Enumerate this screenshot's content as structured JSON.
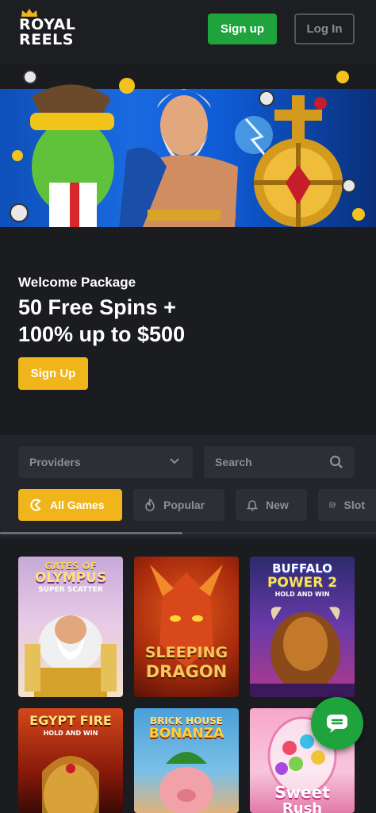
{
  "header": {
    "logo_line1": "ROYAL",
    "logo_line2": "REELS",
    "signup_label": "Sign up",
    "login_label": "Log In"
  },
  "promo": {
    "subtitle": "Welcome Package",
    "title_line1": "50 Free Spins +",
    "title_line2": "100% up to $500",
    "cta_label": "Sign Up"
  },
  "filters": {
    "providers_label": "Providers",
    "search_placeholder": "Search",
    "tabs": [
      {
        "label": "All Games",
        "icon": "all-games-icon",
        "active": true
      },
      {
        "label": "Popular",
        "icon": "flame-icon",
        "active": false
      },
      {
        "label": "New",
        "icon": "bell-icon",
        "active": false
      },
      {
        "label": "Slot",
        "icon": "slot-icon",
        "active": false
      }
    ]
  },
  "games": [
    {
      "title_line1": "GATES OF",
      "title_line2": "OLYMPUS",
      "title_line3": "SUPER SCATTER"
    },
    {
      "title_line1": "SLEEPING",
      "title_line2": "DRAGON"
    },
    {
      "title_line1": "BUFFALO",
      "title_line2": "POWER 2",
      "title_line3": "HOLD AND WIN"
    },
    {
      "title_line1": "EGYPT FIRE",
      "title_line2": "HOLD AND WIN"
    },
    {
      "title_line1": "BRICK HOUSE",
      "title_line2": "BONANZA"
    },
    {
      "title_line1": "Sweet",
      "title_line2": "Rush"
    }
  ],
  "colors": {
    "accent_gold": "#f1b51c",
    "brand_green": "#1fa33c",
    "background": "#1b1c20"
  }
}
